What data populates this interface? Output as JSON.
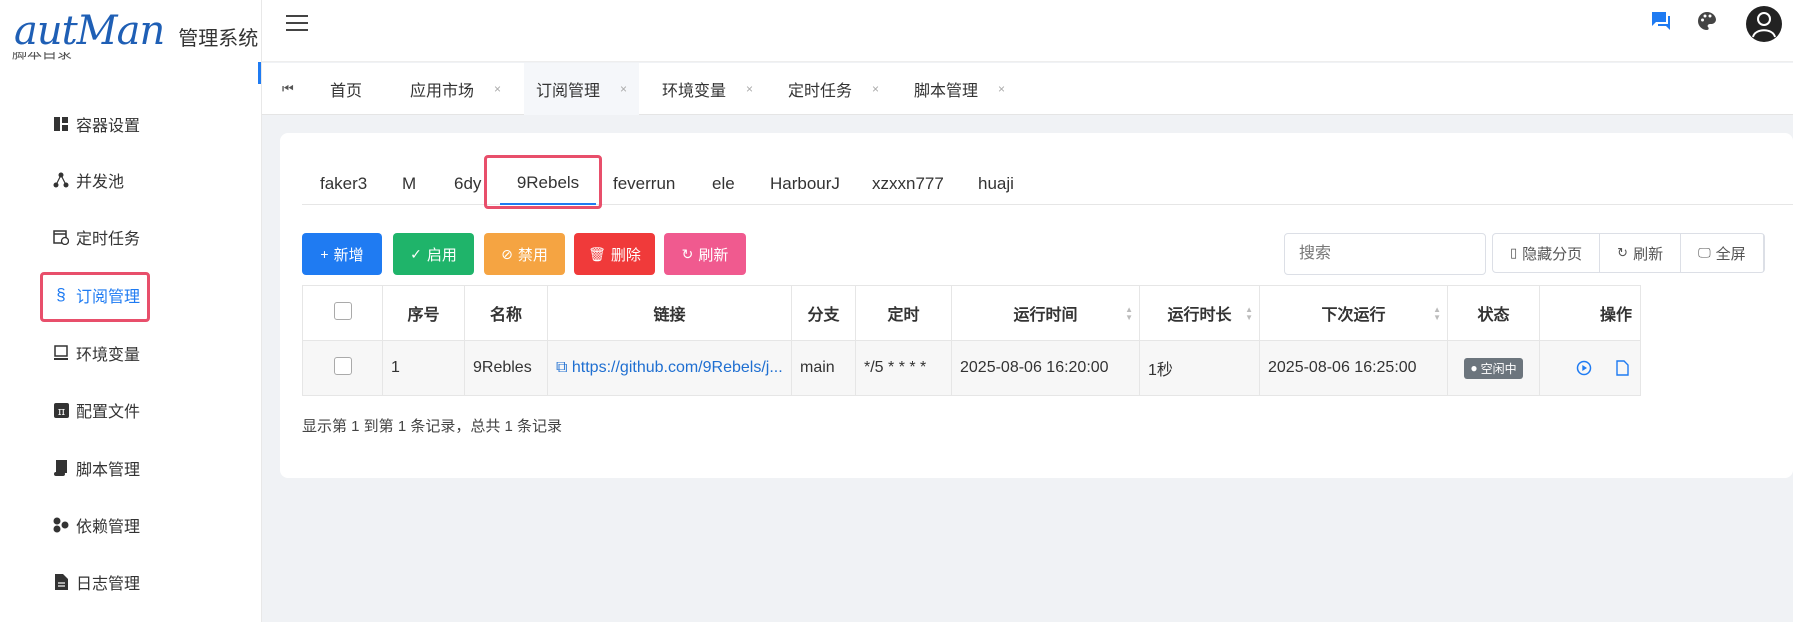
{
  "app": {
    "logo_script": "autMan",
    "logo_title": "管理系统"
  },
  "sidebar": {
    "partial_item": "脚本目录",
    "items": [
      {
        "label": "容器设置",
        "icon": "layout-icon"
      },
      {
        "label": "并发池",
        "icon": "share-nodes-icon"
      },
      {
        "label": "定时任务",
        "icon": "calendar-clock-icon"
      },
      {
        "label": "订阅管理",
        "icon": "section-icon",
        "active": true
      },
      {
        "label": "环境变量",
        "icon": "monitor-icon"
      },
      {
        "label": "配置文件",
        "icon": "pi-icon"
      },
      {
        "label": "脚本管理",
        "icon": "scroll-icon"
      },
      {
        "label": "依赖管理",
        "icon": "cubes-icon"
      },
      {
        "label": "日志管理",
        "icon": "file-icon"
      }
    ]
  },
  "tags": {
    "items": [
      {
        "label": "首页",
        "closable": false
      },
      {
        "label": "应用市场",
        "closable": true
      },
      {
        "label": "订阅管理",
        "closable": true,
        "active": true
      },
      {
        "label": "环境变量",
        "closable": true
      },
      {
        "label": "定时任务",
        "closable": true
      },
      {
        "label": "脚本管理",
        "closable": true
      }
    ],
    "close_glyph": "×"
  },
  "subtabs": [
    "faker3",
    "M",
    "6dy",
    "9Rebels",
    "feverrun",
    "ele",
    "HarbourJ",
    "xzxxn777",
    "huaji"
  ],
  "active_subtab": "9Rebels",
  "toolbar": {
    "add": "新增",
    "enable": "启用",
    "disable": "禁用",
    "delete": "删除",
    "refresh": "刷新",
    "search_placeholder": "搜索",
    "hide_paging": "隐藏分页",
    "refresh2": "刷新",
    "fullscreen": "全屏"
  },
  "colors": {
    "add": "#1f7bf2",
    "enable": "#1fb46a",
    "disable": "#f5a442",
    "delete": "#f03a3a",
    "refresh": "#f05a8f",
    "highlight": "#e84f6b"
  },
  "table": {
    "headers": [
      "序号",
      "名称",
      "链接",
      "分支",
      "定时",
      "运行时间",
      "运行时长",
      "下次运行",
      "状态",
      "操作"
    ],
    "rows": [
      {
        "index": "1",
        "name": "9Rebles",
        "link": "https://github.com/9Rebels/j...",
        "branch": "main",
        "cron": "*/5 * * * *",
        "run_time": "2025-08-06 16:20:00",
        "duration": "1秒",
        "next_run": "2025-08-06 16:25:00",
        "status": "空闲中"
      }
    ]
  },
  "footer": "显示第 1 到第 1 条记录，总共 1 条记录"
}
